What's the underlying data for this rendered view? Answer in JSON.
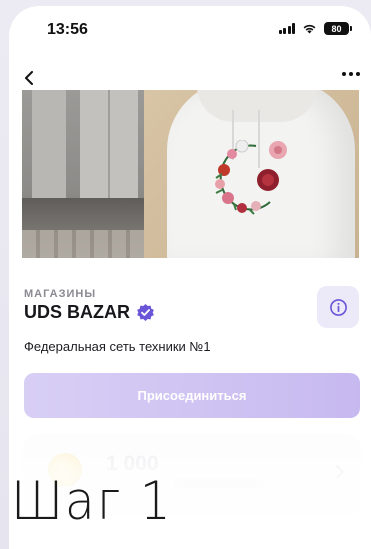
{
  "status_bar": {
    "time": "13:56",
    "battery": "80"
  },
  "nav": {
    "back_icon": "chevron-left-icon",
    "more_icon": "ellipsis-horizontal-icon"
  },
  "store": {
    "category": "МАГАЗИНЫ",
    "name": "UDS BAZAR",
    "verified_icon": "verified-badge-icon",
    "description": "Федеральная сеть техники №1",
    "info_icon": "info-circle-icon",
    "accent_color": "#6a55d8"
  },
  "actions": {
    "join_label": "Присоединиться"
  },
  "points_card": {
    "points": "1 000"
  },
  "overlay": {
    "step_label": "Шаг 1"
  }
}
